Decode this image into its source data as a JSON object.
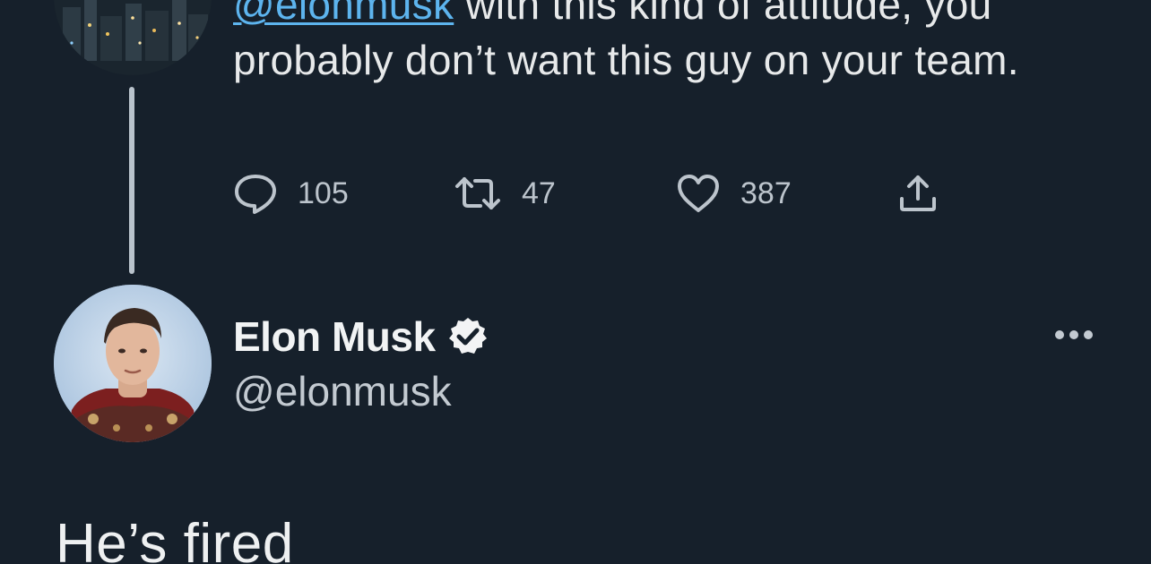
{
  "parent_tweet": {
    "mention": "@elonmusk",
    "text_after_mention": " with this kind of attitude, you probably don’t want this guy on your team.",
    "actions": {
      "reply_count": "105",
      "retweet_count": "47",
      "like_count": "387"
    }
  },
  "reply_tweet": {
    "author_name": "Elon Musk",
    "author_handle": "@elonmusk",
    "verified": true,
    "text": "He’s fired"
  },
  "icons": {
    "reply": "speech-bubble-icon",
    "retweet": "retweet-arrows-icon",
    "like": "heart-icon",
    "share": "share-upload-icon",
    "verified": "verified-badge-icon",
    "more": "more-dots-icon"
  },
  "colors": {
    "background": "#16202b",
    "mention": "#5db4ee",
    "text": "#e7e9ea",
    "muted": "#bcc4cc",
    "thread_line": "#b9c3cc"
  }
}
